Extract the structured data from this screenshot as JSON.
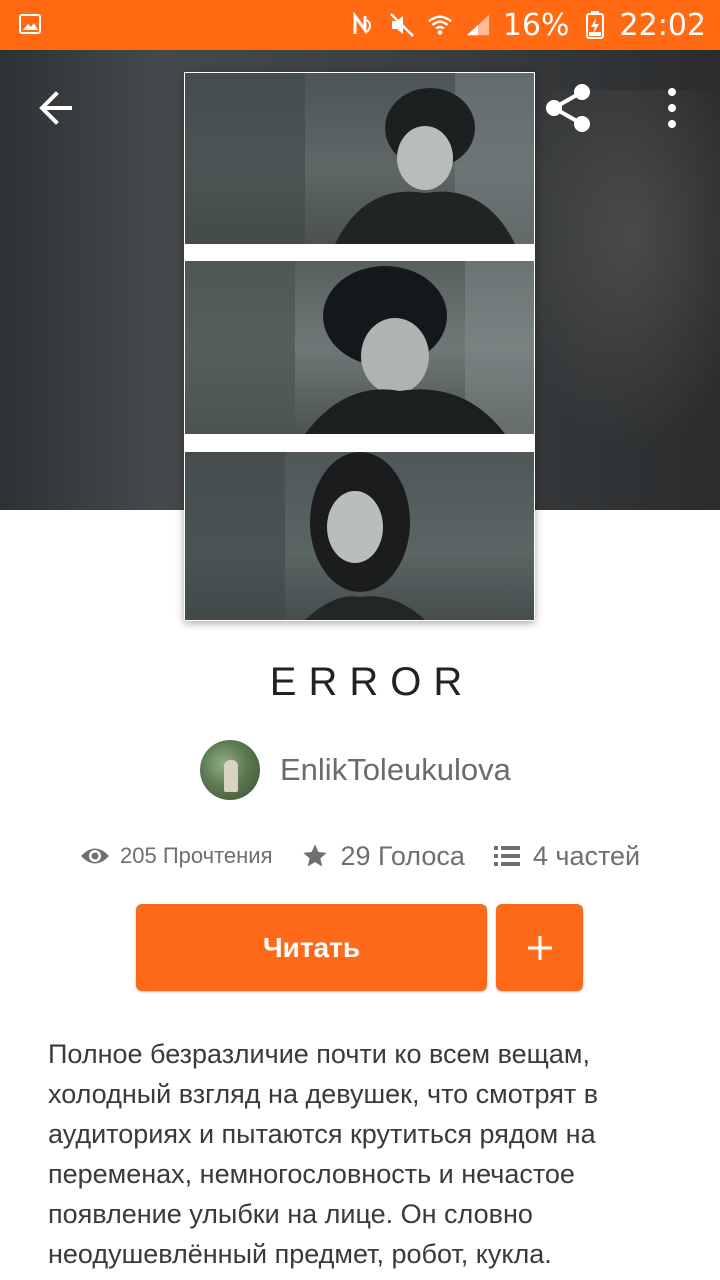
{
  "status_bar": {
    "battery": "16%",
    "time": "22:02",
    "icons": [
      "gallery-icon",
      "nfc-icon",
      "mute-icon",
      "wifi-icon",
      "signal-icon",
      "battery-charging-icon"
    ]
  },
  "toolbar": {
    "back_icon": "arrow-back-icon",
    "share_icon": "share-icon",
    "more_icon": "more-vert-icon"
  },
  "story": {
    "title": "ERROR",
    "author": "EnlikToleukulova",
    "stats": {
      "reads": "205 Прочтения",
      "votes": "29 Голоса",
      "parts": "4 частей"
    },
    "read_button": "Читать",
    "add_button": "+",
    "description_lines": [
      "Полное безразличие почти ко всем вещам,",
      "холодный взгляд на девушек, что смотрят в",
      "аудиториях и пытаются крутиться рядом на",
      "переменах, немногословность и нечастое",
      "появление улыбки на лице. Он словно",
      "неодушевлённый предмет, робот, кукла."
    ]
  },
  "colors": {
    "accent": "#ff6a13",
    "button": "#ff6a1a",
    "header_bg": "#3b3e40"
  }
}
